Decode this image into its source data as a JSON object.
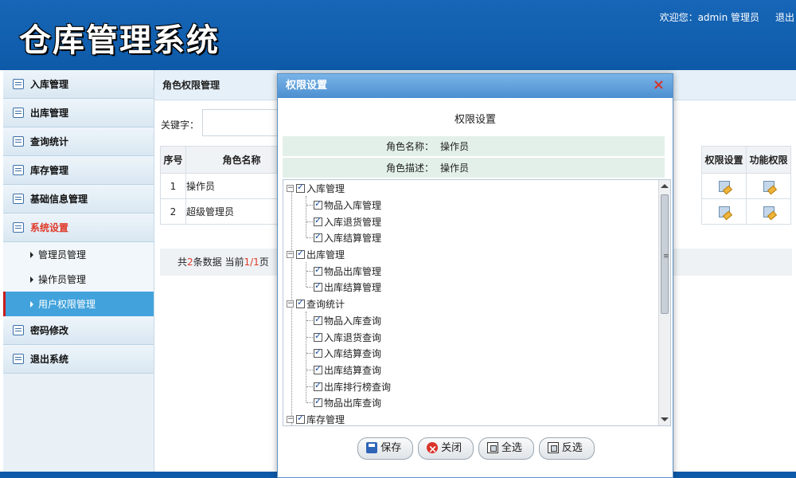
{
  "header": {
    "title": "仓库管理系统",
    "welcome": "欢迎您：admin 管理员",
    "logout": "退出"
  },
  "sidebar": {
    "items": [
      {
        "label": "入库管理"
      },
      {
        "label": "出库管理"
      },
      {
        "label": "查询统计"
      },
      {
        "label": "库存管理"
      },
      {
        "label": "基础信息管理"
      },
      {
        "label": "系统设置"
      },
      {
        "label": "密码修改"
      },
      {
        "label": "退出系统"
      }
    ],
    "subitems": [
      {
        "label": "管理员管理"
      },
      {
        "label": "操作员管理"
      },
      {
        "label": "用户权限管理"
      }
    ]
  },
  "main": {
    "breadcrumb": "角色权限管理",
    "search_label": "关键字：",
    "table": {
      "headers": [
        "序号",
        "角色名称"
      ],
      "rows": [
        {
          "no": "1",
          "name": "操作员"
        },
        {
          "no": "2",
          "name": "超级管理员"
        }
      ],
      "right_headers": [
        "权限设置",
        "功能权限"
      ]
    },
    "pager": {
      "prefix": "共",
      "total": "2",
      "mid": "条数据 当前",
      "page": "1/1",
      "suffix": "页"
    }
  },
  "dialog": {
    "title": "权限设置",
    "close": "×",
    "heading": "权限设置",
    "role_name_label": "角色名称：",
    "role_name_value": "操作员",
    "role_desc_label": "角色描述：",
    "role_desc_value": "操作员",
    "tree": [
      {
        "label": "入库管理",
        "children": [
          "物品入库管理",
          "入库退货管理",
          "入库结算管理"
        ]
      },
      {
        "label": "出库管理",
        "children": [
          "物品出库管理",
          "出库结算管理"
        ]
      },
      {
        "label": "查询统计",
        "children": [
          "物品入库查询",
          "入库退货查询",
          "入库结算查询",
          "出库结算查询",
          "出库排行榜查询",
          "物品出库查询"
        ]
      },
      {
        "label": "库存管理",
        "children": []
      }
    ],
    "buttons": {
      "save": "保存",
      "close": "关闭",
      "select_all": "全选",
      "invert": "反选"
    }
  }
}
